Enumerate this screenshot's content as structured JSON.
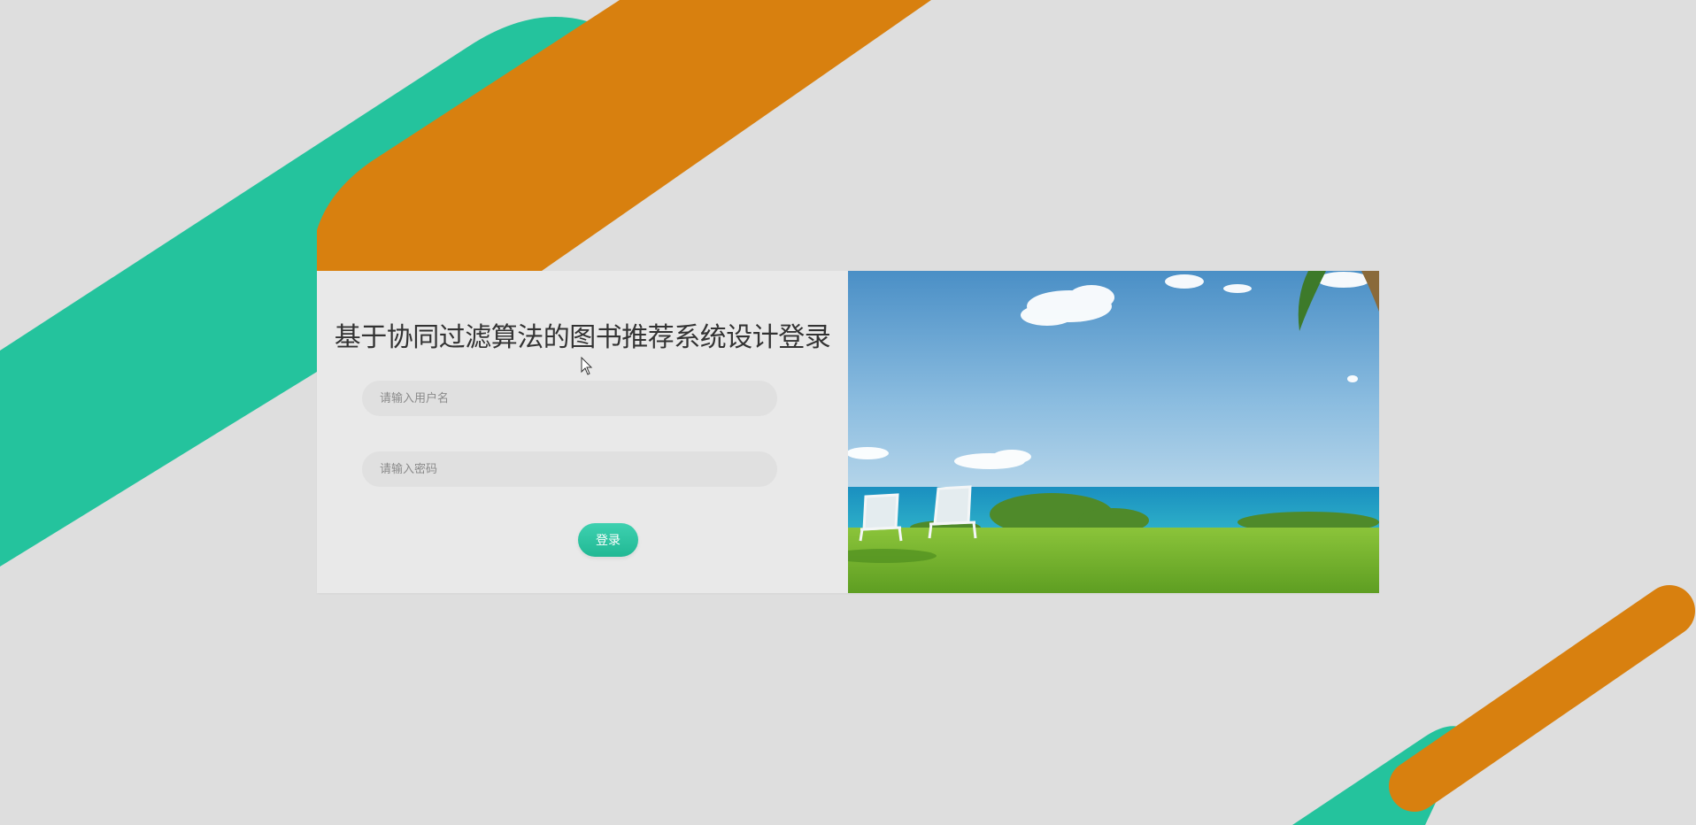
{
  "login": {
    "title": "基于协同过滤算法的图书推荐系统设计登录",
    "username_placeholder": "请输入用户名",
    "username_value": "",
    "password_placeholder": "请输入密码",
    "password_value": "",
    "submit_label": "登录"
  },
  "theme": {
    "teal": "#24c39d",
    "orange": "#d8800f",
    "background": "#dedede",
    "panel": "#e9e9e9"
  },
  "icons": {
    "cursor": "mouse-cursor-icon"
  }
}
